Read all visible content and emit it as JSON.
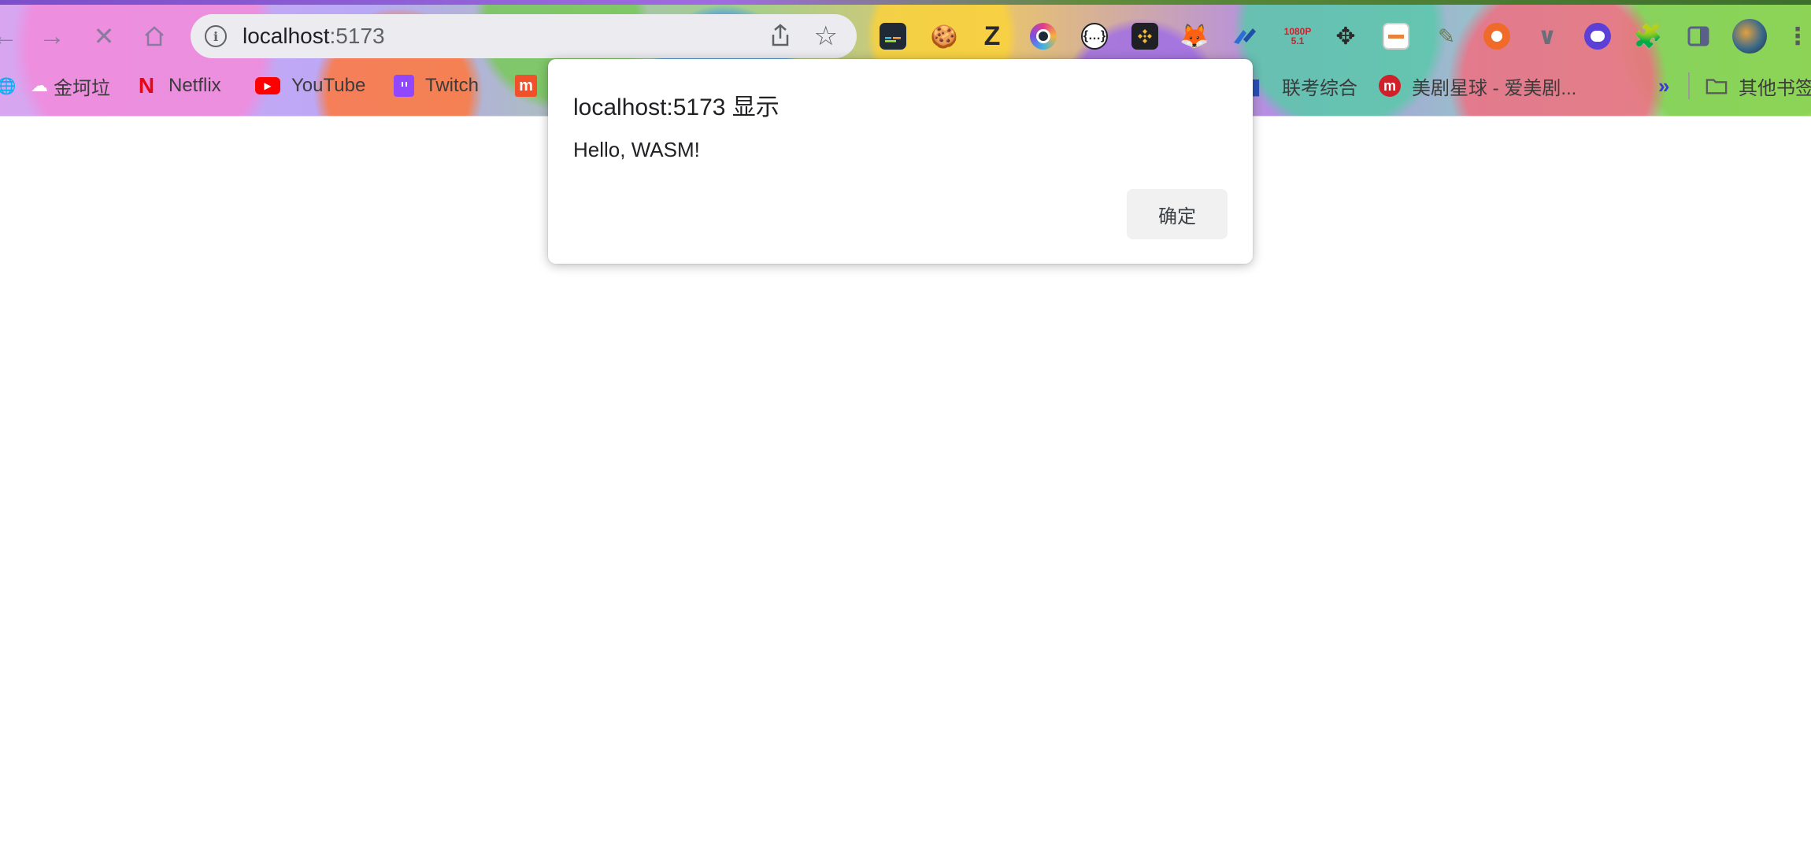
{
  "browser": {
    "address_bar": {
      "host": "localhost",
      "port": ":5173"
    },
    "nav_icons": [
      "back-icon",
      "forward-icon",
      "stop-loading-icon",
      "home-icon"
    ],
    "bookmarks": [
      {
        "label": "金坷垃",
        "icon": "weather-icon"
      },
      {
        "label": "Netflix",
        "icon": "netflix-icon"
      },
      {
        "label": "YouTube",
        "icon": "youtube-icon"
      },
      {
        "label": "Twitch",
        "icon": "twitch-icon"
      },
      {
        "label": "",
        "icon": "mi-icon"
      },
      {
        "label": "联考综合",
        "icon": "bookmark-icon"
      },
      {
        "label": "美剧星球 - 爱美剧...",
        "icon": "meiju-icon"
      }
    ],
    "bookmarks_overflow": "»",
    "other_bookmarks": "其他书签",
    "extension_badge": {
      "line1": "1080P",
      "line2": "5.1"
    }
  },
  "dialog": {
    "title": "localhost:5173 显示",
    "message": "Hello, WASM!",
    "ok_label": "确定"
  }
}
